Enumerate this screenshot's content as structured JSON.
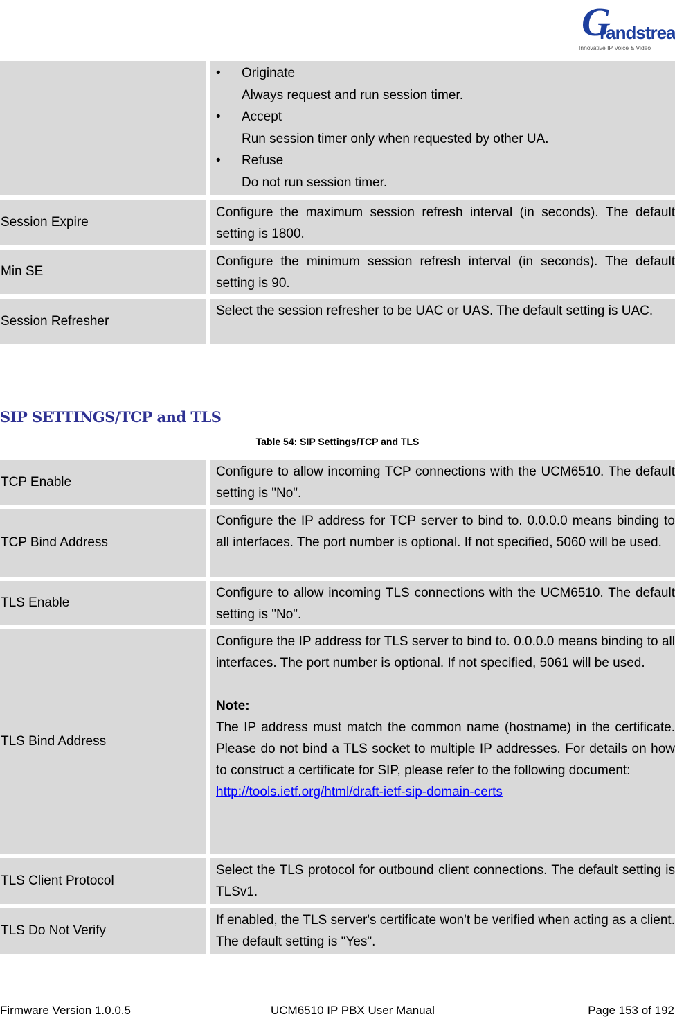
{
  "header": {
    "logo": {
      "mark": "G",
      "wordmark": "randstream",
      "tagline": "Innovative IP Voice & Video"
    }
  },
  "session_table": {
    "rows": [
      {
        "name": "",
        "options": [
          {
            "bullet": "•",
            "label": "Originate",
            "desc": "Always request and run session timer."
          },
          {
            "bullet": "•",
            "label": "Accept",
            "desc": "Run session timer only when requested by other UA."
          },
          {
            "bullet": "•",
            "label": "Refuse",
            "desc": "Do not run session timer."
          }
        ]
      },
      {
        "name": "Session Expire",
        "desc": "Configure the maximum session refresh interval (in seconds). The default setting is 1800."
      },
      {
        "name": "Min SE",
        "desc": "Configure the minimum session refresh interval (in seconds). The default setting is 90."
      },
      {
        "name": "Session Refresher",
        "desc": "Select the session refresher to be UAC or UAS. The default setting is UAC."
      }
    ]
  },
  "section": {
    "heading": "SIP SETTINGS/TCP and TLS",
    "caption": "Table 54: SIP Settings/TCP and TLS"
  },
  "tcp_tls_table": {
    "rows": [
      {
        "name": "TCP Enable",
        "desc": "Configure to allow incoming TCP connections with the UCM6510. The default setting is \"No\"."
      },
      {
        "name": "TCP Bind Address",
        "desc": "Configure the IP address for TCP server to bind to. 0.0.0.0 means binding to all interfaces. The port number is optional. If not specified, 5060 will be used."
      },
      {
        "name": "TLS Enable",
        "desc": "Configure to allow incoming TLS connections with the UCM6510. The default setting is \"No\"."
      },
      {
        "name": "TLS Bind Address",
        "desc": "Configure the IP address for TLS server to bind to. 0.0.0.0 means binding to all interfaces. The port number is optional. If not specified, 5061 will be used.",
        "note_label": "Note:",
        "note": "The IP address must match the common name (hostname) in the certificate. Please do not bind a TLS socket to multiple IP addresses. For details on how to construct a certificate for SIP, please refer to the following document:",
        "link": "http://tools.ietf.org/html/draft-ietf-sip-domain-certs"
      },
      {
        "name": "TLS Client Protocol",
        "desc": "Select the TLS protocol for outbound client connections. The default setting is TLSv1."
      },
      {
        "name": "TLS Do Not Verify",
        "desc": "If enabled, the TLS server's certificate won't be verified when acting as a client. The default setting is \"Yes\"."
      }
    ]
  },
  "footer": {
    "firmware": "Firmware Version 1.0.0.5",
    "manual": "UCM6510 IP PBX User Manual",
    "page": "Page 153 of 192"
  },
  "colors": {
    "heading": "#2e3192",
    "cell_bg": "#d9d9d9",
    "link": "#0000ff"
  }
}
